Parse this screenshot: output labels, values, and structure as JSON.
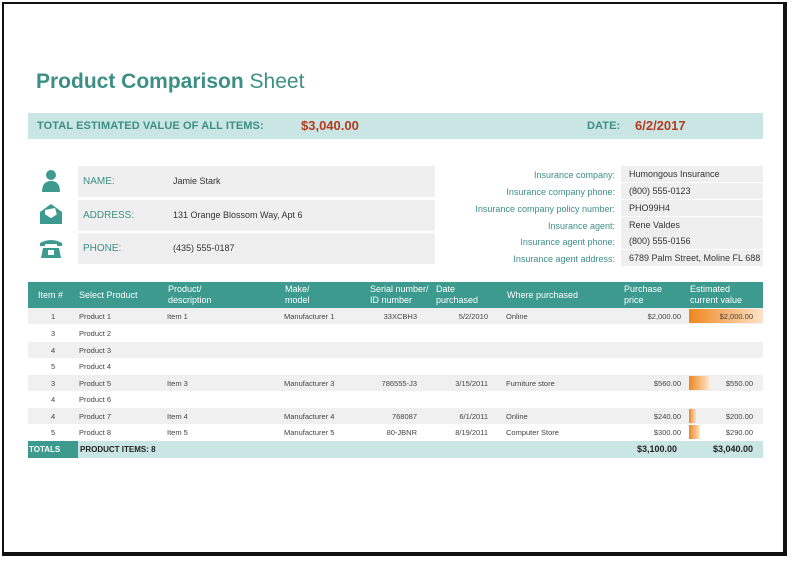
{
  "title": {
    "bold": "Product Comparison",
    "light": " Sheet"
  },
  "summary": {
    "total_label": "TOTAL ESTIMATED VALUE OF ALL ITEMS:",
    "total_value": "$3,040.00",
    "date_label": "DATE:",
    "date_value": "6/2/2017"
  },
  "contact": [
    {
      "icon": "person-icon",
      "label": "NAME:",
      "value": "Jamie Stark"
    },
    {
      "icon": "envelope-icon",
      "label": "ADDRESS:",
      "value": "131 Orange Blossom Way, Apt 6"
    },
    {
      "icon": "telephone-icon",
      "label": "PHONE:",
      "value": "(435) 555-0187"
    }
  ],
  "insurance": [
    {
      "label": "Insurance company:",
      "value": "Humongous Insurance"
    },
    {
      "label": "Insurance company phone:",
      "value": "(800) 555-0123"
    },
    {
      "label": "Insurance company policy number:",
      "value": "PHO99H4"
    },
    {
      "label": "Insurance agent:",
      "value": "Rene Valdes"
    },
    {
      "label": "Insurance agent phone:",
      "value": "(800) 555-0156"
    },
    {
      "label": "Insurance agent address:",
      "value": "6789 Palm Street, Moline FL 688"
    }
  ],
  "table": {
    "headers": {
      "item": "Item #",
      "select": "Select Product",
      "desc1": "Product/",
      "desc2": "description",
      "make1": "Make/",
      "make2": "model",
      "serial1": "Serial number/",
      "serial2": "ID number",
      "date1": "Date",
      "date2": "purchased",
      "where": "Where purchased",
      "price1": "Purchase",
      "price2": "price",
      "est1": "Estimated",
      "est2": "current value"
    },
    "rows": [
      {
        "item": "1",
        "product": "Product 1",
        "desc": "Item 1",
        "make": "Manufacturer 1",
        "serial": "33XCBH3",
        "date": "5/2/2010",
        "where": "Online",
        "price": "$2,000.00",
        "value": "$2,000.00",
        "value_num": 2000
      },
      {
        "item": "3",
        "product": "Product 2",
        "desc": "",
        "make": "",
        "serial": "",
        "date": "",
        "where": "",
        "price": "",
        "value": "",
        "value_num": 0
      },
      {
        "item": "4",
        "product": "Product 3",
        "desc": "",
        "make": "",
        "serial": "",
        "date": "",
        "where": "",
        "price": "",
        "value": "",
        "value_num": 0
      },
      {
        "item": "5",
        "product": "Product 4",
        "desc": "",
        "make": "",
        "serial": "",
        "date": "",
        "where": "",
        "price": "",
        "value": "",
        "value_num": 0
      },
      {
        "item": "3",
        "product": "Product 5",
        "desc": "Item 3",
        "make": "Manufacturer 3",
        "serial": "786555-J3",
        "date": "3/15/2011",
        "where": "Furniture store",
        "price": "$560.00",
        "value": "$550.00",
        "value_num": 550
      },
      {
        "item": "4",
        "product": "Product 6",
        "desc": "",
        "make": "",
        "serial": "",
        "date": "",
        "where": "",
        "price": "",
        "value": "",
        "value_num": 0
      },
      {
        "item": "4",
        "product": "Product 7",
        "desc": "Item 4",
        "make": "Manufacturer 4",
        "serial": "768087",
        "date": "6/1/2011",
        "where": "Online",
        "price": "$240.00",
        "value": "$200.00",
        "value_num": 200
      },
      {
        "item": "5",
        "product": "Product 8",
        "desc": "Item 5",
        "make": "Manufacturer 5",
        "serial": "80-JBNR",
        "date": "8/19/2011",
        "where": "Computer Store",
        "price": "$300.00",
        "value": "$290.00",
        "value_num": 290
      }
    ],
    "totals": {
      "label": "TOTALS",
      "count": "PRODUCT ITEMS: 8",
      "price": "$3,100.00",
      "value": "$3,040.00"
    },
    "bar_max": 2000
  },
  "colors": {
    "accent": "#3d9a8f",
    "light_accent": "#c9e6e4",
    "highlight": "#b53a1f",
    "bar": "#f0861e"
  }
}
